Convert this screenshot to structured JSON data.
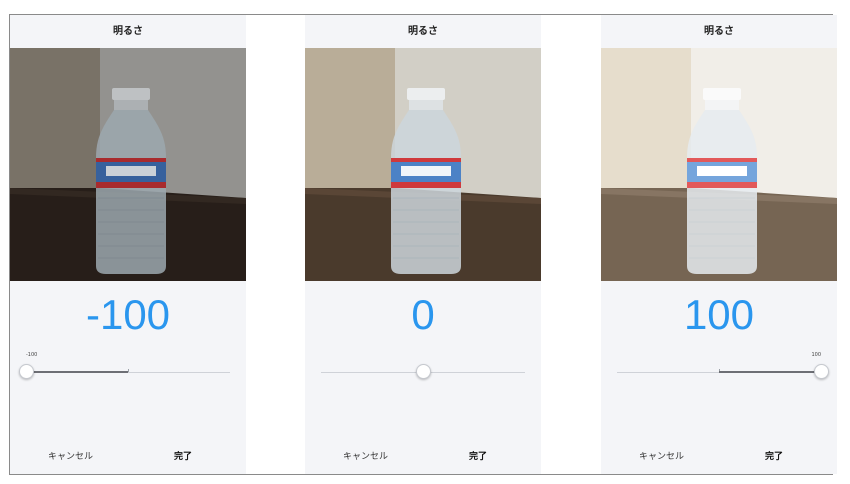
{
  "panels": [
    {
      "title": "明るさ",
      "value_label": "-100",
      "brightness": -100,
      "slider_fraction": 0.0,
      "slider_limit_label": "-100",
      "cancel_label": "キャンセル",
      "done_label": "完了"
    },
    {
      "title": "明るさ",
      "value_label": "0",
      "brightness": 0,
      "slider_fraction": 0.5,
      "slider_limit_label": "",
      "cancel_label": "キャンセル",
      "done_label": "完了"
    },
    {
      "title": "明るさ",
      "value_label": "100",
      "brightness": 100,
      "slider_fraction": 1.0,
      "slider_limit_label": "100",
      "cancel_label": "キャンセル",
      "done_label": "完了"
    }
  ],
  "colors": {
    "value_text": "#2a96ee",
    "screen_background": "#f4f5f8",
    "frame_border": "#8a8a8a"
  },
  "photo": {
    "subject": "water bottle on wooden table",
    "label_text": "CRYSTAL GEYSER"
  }
}
